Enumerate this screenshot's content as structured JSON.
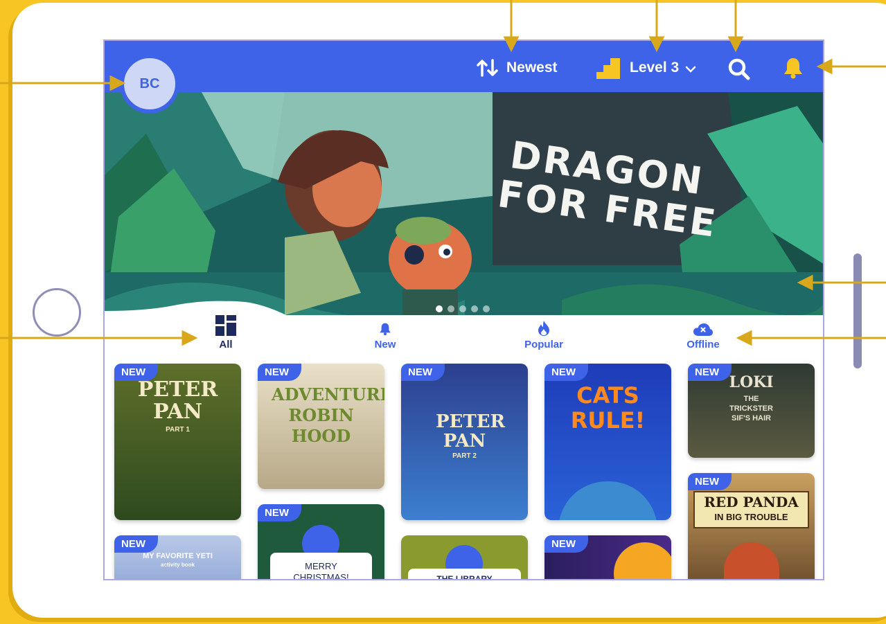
{
  "avatar": {
    "initials": "BC"
  },
  "toolbar": {
    "sort_label": "Newest",
    "level_label": "Level 3",
    "icons": [
      "sort-arrows-icon",
      "level-stairs-icon",
      "chevron-down-icon",
      "search-icon",
      "bell-icon"
    ]
  },
  "banner": {
    "line1": "DRAGON",
    "line2": "FOR FREE",
    "slide_count": 5,
    "active_slide": 1
  },
  "tabs": [
    {
      "label": "All",
      "icon": "grid-icon",
      "active": true
    },
    {
      "label": "New",
      "icon": "bell-icon",
      "active": false
    },
    {
      "label": "Popular",
      "icon": "flame-icon",
      "active": false
    },
    {
      "label": "Offline",
      "icon": "cloud-offline-icon",
      "active": false
    }
  ],
  "badge_label": "NEW",
  "books": [
    {
      "title": "PETER PAN",
      "subtitle": "PART 1",
      "badge": true
    },
    {
      "title": "ADVENTURE ROBIN HOOD",
      "subtitle": "",
      "badge": true
    },
    {
      "title": "PETER PAN",
      "subtitle": "PART 2",
      "badge": true
    },
    {
      "title": "CATS RULE!",
      "subtitle": "",
      "badge": true
    },
    {
      "title": "LOKI",
      "subtitle": "THE TRICKSTER SIF'S HAIR",
      "badge": true
    },
    {
      "title": "MY FAVORITE YETI",
      "subtitle": "activity book",
      "badge": true
    },
    {
      "title": "MERRY CHRISTMAS!",
      "subtitle": "",
      "badge": true
    },
    {
      "title": "THE LIBRARY",
      "subtitle": "",
      "badge": false
    },
    {
      "title": "",
      "subtitle": "",
      "badge": true
    },
    {
      "title": "RED PANDA",
      "subtitle": "IN BIG TROUBLE",
      "badge": true
    }
  ],
  "colors": {
    "brand_blue": "#3E63E8",
    "frame_yellow": "#F8C624",
    "arrow_gold": "#D8A81A",
    "level_icon": "#F8C624"
  }
}
